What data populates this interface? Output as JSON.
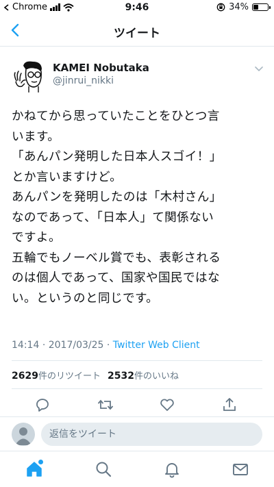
{
  "status_bar": {
    "carrier": "Chrome",
    "time": "9:46",
    "battery_percent": "34%",
    "battery_level": 0.34
  },
  "nav": {
    "title": "ツイート"
  },
  "tweet": {
    "author_name": "KAMEI Nobutaka",
    "author_handle": "@jinrui_nikki",
    "text_lines": [
      "かねてから思っていたことをひとつ言",
      "います。",
      "「あんパン発明した日本人スゴイ！」",
      "とか言いますけど。",
      "あんパンを発明したのは「木村さん」",
      "なのであって、「日本人」て関係ない",
      "ですよ。",
      "五輪でもノーベル賞でも、表彰される",
      "のは個人であって、国家や国民ではな",
      "い。というのと同じです。"
    ],
    "time": "14:14",
    "date": "2017/03/25",
    "separator": "·",
    "client": "Twitter Web Client",
    "retweet_count": "2629",
    "retweet_label": "件のリツイート",
    "like_count": "2532",
    "like_label": "件のいいね"
  },
  "reply": {
    "placeholder": "返信をツイート"
  },
  "colors": {
    "accent": "#1da1f2",
    "secondary_text": "#657786",
    "divider": "#e1e8ed"
  },
  "icons": {
    "back": "chevron-left-icon",
    "caret": "chevron-down-icon",
    "reply": "reply-icon",
    "retweet": "retweet-icon",
    "like": "heart-icon",
    "share": "share-icon",
    "home": "home-icon",
    "search": "search-icon",
    "notifications": "bell-icon",
    "messages": "mail-icon"
  }
}
